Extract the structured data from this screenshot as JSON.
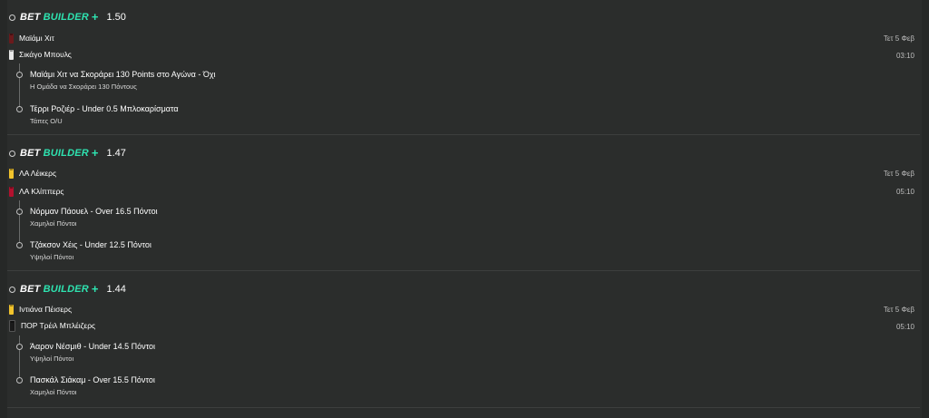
{
  "brand": {
    "bet": "BET",
    "builder": "BUILDER",
    "plus": "+"
  },
  "cards": [
    {
      "odds": "1.50",
      "team1": {
        "name": "Μαϊάμι Χιτ",
        "jersey_color": "#6b1a1c"
      },
      "team2": {
        "name": "Σικάγο Μπουλς",
        "jersey_color": "#e8e8e8"
      },
      "date": "Τετ 5 Φεβ",
      "time": "03:10",
      "legs": [
        {
          "title": "Μαϊάμι Χιτ να Σκοράρει 130 Points στο Αγώνα - Όχι",
          "subtitle": "Η Ομάδα να Σκοράρει 130 Πόντους"
        },
        {
          "title": "Τέρρι Ροζιέρ - Under 0.5 Μπλοκαρίσματα",
          "subtitle": "Τάπες O/U"
        }
      ]
    },
    {
      "odds": "1.47",
      "team1": {
        "name": "ΛΑ Λέικερς",
        "jersey_color": "#f2c42c"
      },
      "team2": {
        "name": "ΛΑ Κλίππερς",
        "jersey_color": "#b3112e"
      },
      "date": "Τετ 5 Φεβ",
      "time": "05:10",
      "legs": [
        {
          "title": "Νόρμαν Πάουελ - Over 16.5 Πόντοι",
          "subtitle": "Χαμηλοί Πόντοι"
        },
        {
          "title": "Τζάκσον Χέις - Under 12.5 Πόντοι",
          "subtitle": "Υψηλοί Πόντοι"
        }
      ]
    },
    {
      "odds": "1.44",
      "team1": {
        "name": "Ιντιάνα Πέισερς",
        "jersey_color": "#f2c42c"
      },
      "team2": {
        "name": "ΠΟΡ Τρέιλ Μπλέιζερς",
        "jersey_color": "#1a1a1a"
      },
      "date": "Τετ 5 Φεβ",
      "time": "05:10",
      "legs": [
        {
          "title": "Άαρον Νέσμιθ - Under 14.5 Πόντοι",
          "subtitle": "Υψηλοί Πόντοι"
        },
        {
          "title": "Πασκάλ Σιάκαμ - Over 15.5 Πόντοι",
          "subtitle": "Χαμηλοί Πόντοι"
        }
      ]
    }
  ]
}
